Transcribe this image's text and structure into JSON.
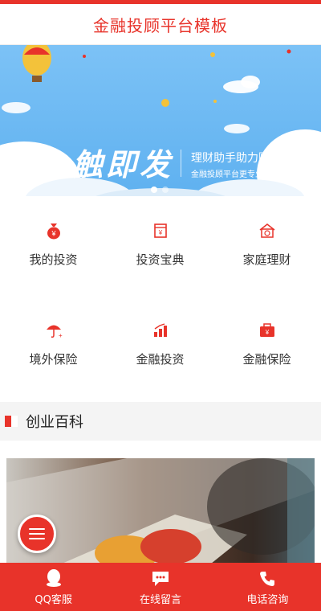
{
  "header": {
    "title": "金融投顾平台模板"
  },
  "banner": {
    "slogan": "一触即发",
    "line1": "理财助手助力财富增值",
    "line2": "金融投顾平台更专业才能更放心",
    "slides": 2,
    "active_slide": 1
  },
  "nav": {
    "items": [
      {
        "label": "我的投资",
        "icon": "money-bag-icon"
      },
      {
        "label": "投资宝典",
        "icon": "book-icon"
      },
      {
        "label": "家庭理财",
        "icon": "house-icon"
      },
      {
        "label": "境外保险",
        "icon": "umbrella-icon"
      },
      {
        "label": "金融投资",
        "icon": "coins-growth-icon"
      },
      {
        "label": "金融保险",
        "icon": "briefcase-icon"
      }
    ]
  },
  "section": {
    "title": "创业百科"
  },
  "footer": {
    "items": [
      {
        "label": "QQ客服",
        "icon": "qq-icon"
      },
      {
        "label": "在线留言",
        "icon": "chat-icon"
      },
      {
        "label": "电话咨询",
        "icon": "phone-icon"
      }
    ]
  },
  "colors": {
    "accent": "#e8332a",
    "banner": "#6bb8f3"
  }
}
